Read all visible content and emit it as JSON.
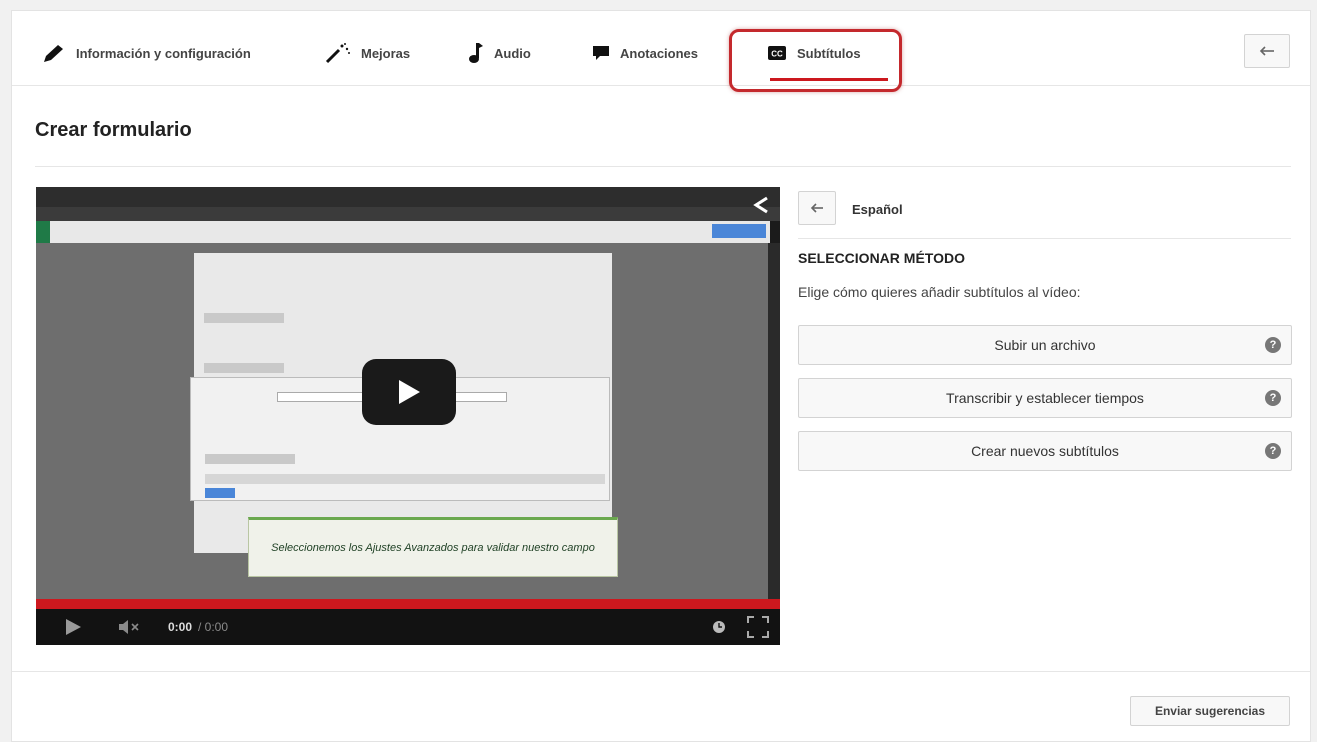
{
  "tabs": [
    {
      "label": "Información y configuración",
      "icon": "pencil-icon"
    },
    {
      "label": "Mejoras",
      "icon": "magic-wand-icon"
    },
    {
      "label": "Audio",
      "icon": "music-note-icon"
    },
    {
      "label": "Anotaciones",
      "icon": "speech-bubble-icon"
    },
    {
      "label": "Subtítulos",
      "icon": "cc-icon",
      "active": true
    }
  ],
  "page": {
    "title": "Crear formulario"
  },
  "video": {
    "time_current": "0:00",
    "time_total": "/ 0:00",
    "tooltip_text": "Seleccionemos los Ajustes Avanzados para validar nuestro campo"
  },
  "sidebar": {
    "language": "Español",
    "method_heading": "SELECCIONAR MÉTODO",
    "method_description": "Elige cómo quieres añadir subtítulos al vídeo:",
    "options": [
      {
        "label": "Subir un archivo"
      },
      {
        "label": "Transcribir y establecer tiempos"
      },
      {
        "label": "Crear nuevos subtítulos"
      }
    ]
  },
  "footer": {
    "feedback_label": "Enviar sugerencias"
  },
  "colors": {
    "accent": "#cc181e",
    "highlight_border": "#c4292d"
  }
}
